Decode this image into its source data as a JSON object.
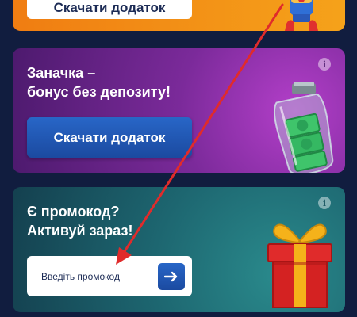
{
  "top_card": {
    "button_label": "Скачати додаток"
  },
  "bonus_card": {
    "title_line1": "Заначка –",
    "title_line2": "бонус без депозиту!",
    "button_label": "Скачати додаток",
    "info_glyph": "i"
  },
  "promo_card": {
    "title_line1": "Є промокод?",
    "title_line2": "Активуй зараз!",
    "input_placeholder": "Введіть промокод",
    "submit_icon": "arrow-right-icon",
    "info_glyph": "i"
  },
  "colors": {
    "orange": "#f5a21a",
    "purple": "#7b2a9a",
    "teal": "#1d6670",
    "button_blue": "#1b4aa0",
    "annotation_red": "#e02b2b"
  }
}
